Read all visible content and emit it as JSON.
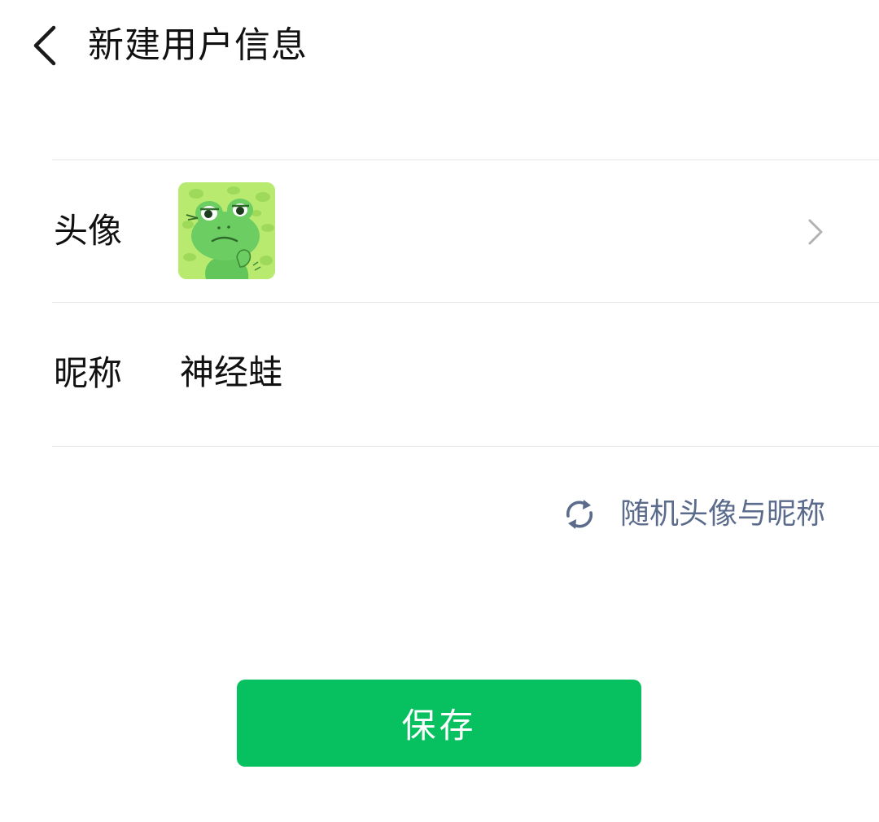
{
  "header": {
    "title": "新建用户信息",
    "back_icon": "chevron-left-icon"
  },
  "avatar_row": {
    "label": "头像",
    "avatar_icon": "frog-avatar",
    "chevron_icon": "chevron-right-icon"
  },
  "nickname_row": {
    "label": "昵称",
    "value": "神经蛙"
  },
  "random": {
    "label": "随机头像与昵称",
    "icon": "refresh-icon",
    "color": "#5b6b8c"
  },
  "save": {
    "label": "保存",
    "color": "#07c160"
  }
}
